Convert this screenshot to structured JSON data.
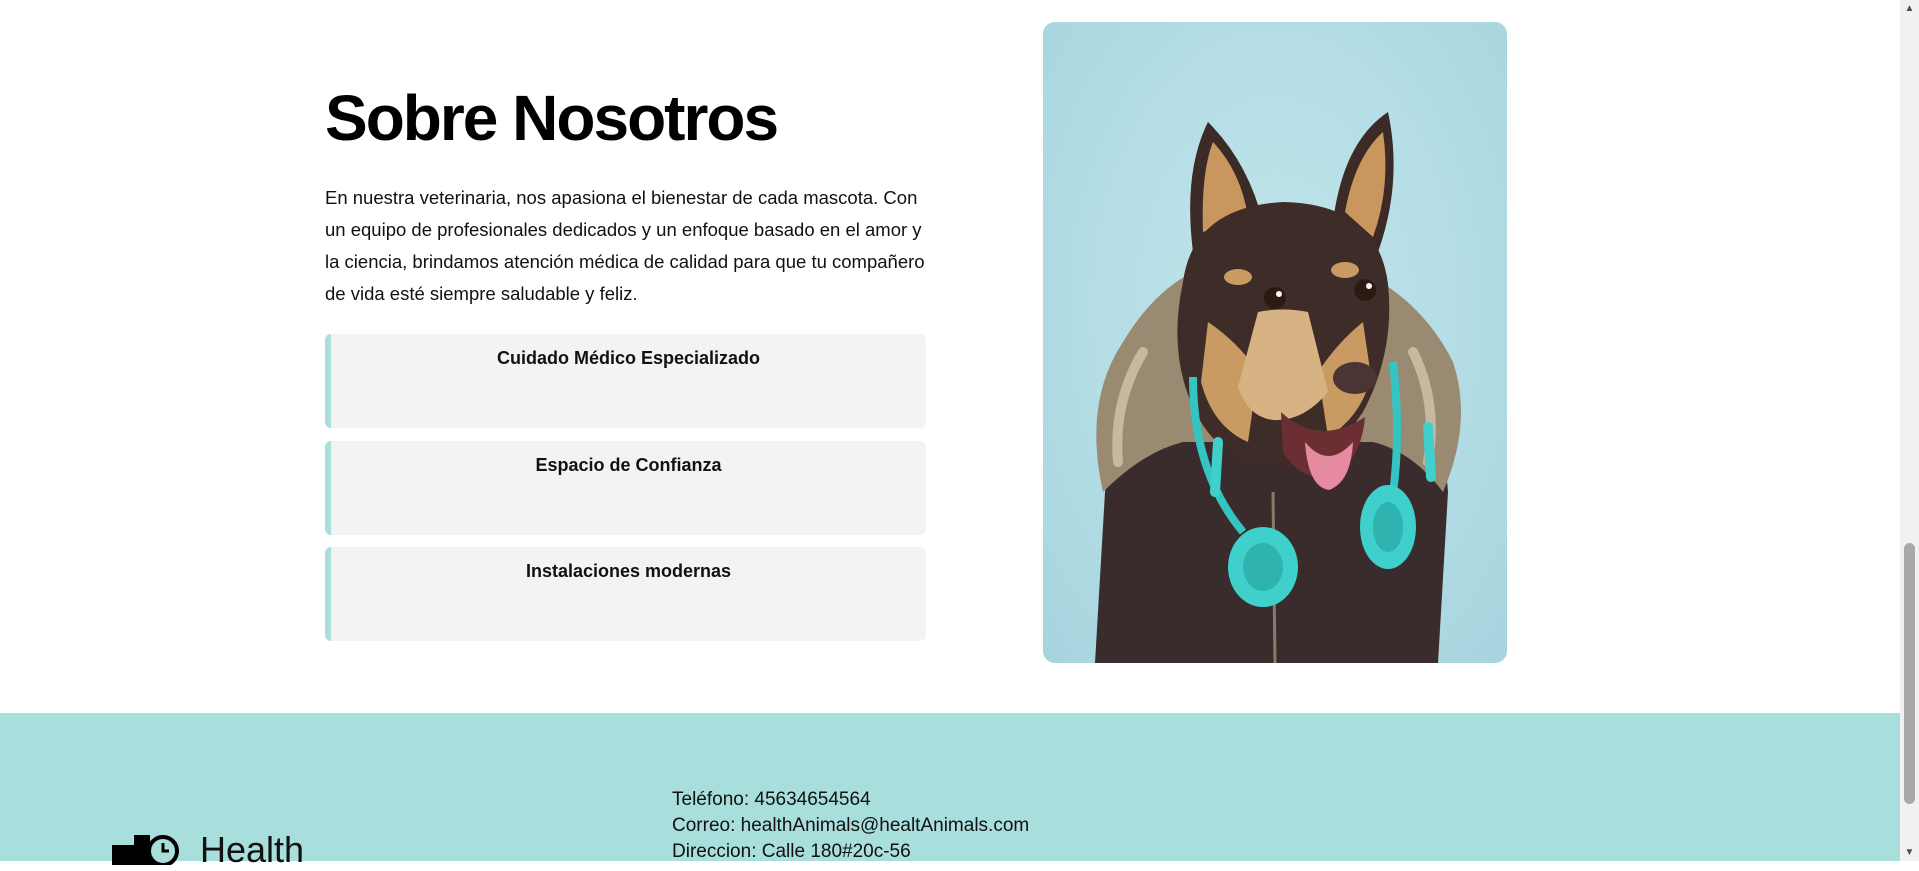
{
  "about": {
    "title": "Sobre Nosotros",
    "text": "En nuestra veterinaria, nos apasiona el bienestar de cada mascota. Con un equipo de profesionales dedicados y un enfoque basado en el amor y la ciencia, brindamos atención médica de calidad para que tu compañero de vida esté siempre saludable y feliz.",
    "features": [
      {
        "title": "Cuidado Médico Especializado"
      },
      {
        "title": "Espacio de Confianza"
      },
      {
        "title": "Instalaciones modernas"
      }
    ],
    "photo_icon": "dog-with-headphones-photo"
  },
  "footer": {
    "phone": "Teléfono: 45634654564",
    "email": "Correo: healthAnimals@healtAnimals.com",
    "address": "Direccion: Calle 180#20c-56",
    "logo_text": "Health",
    "logo_icon": "medical-cross-icon"
  },
  "colors": {
    "accent": "#a8dfdc",
    "card_bg": "#f3f3f3",
    "photo_bg": "#b4dde5"
  }
}
